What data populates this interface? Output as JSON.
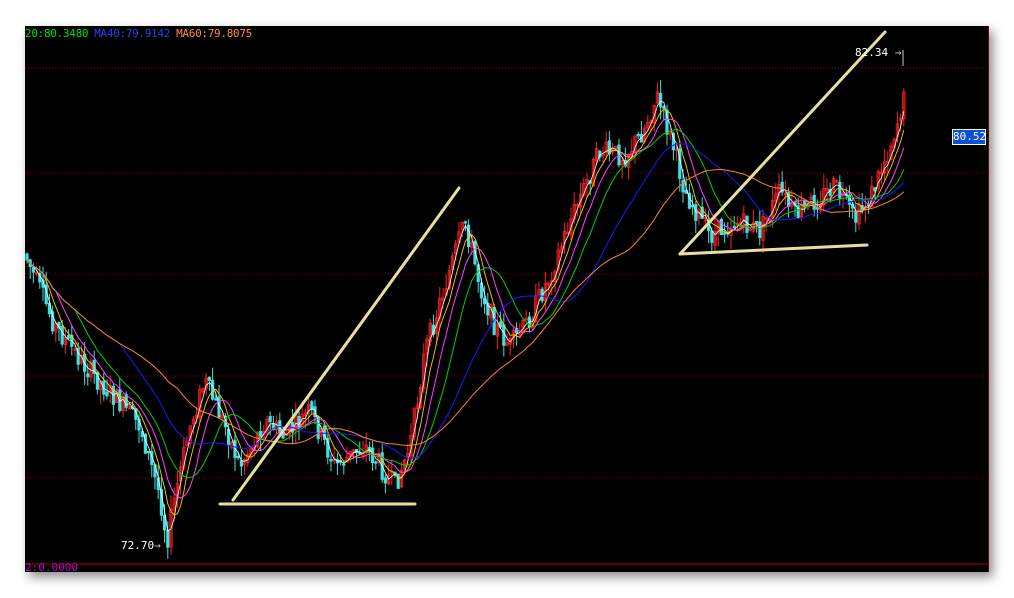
{
  "legend": {
    "ma20": "20:80.3480",
    "ma40": "MA40:79.9142",
    "ma60": "MA60:79.8075"
  },
  "price_labels": {
    "high": "82.34",
    "low": "72.70",
    "current": "80.52"
  },
  "indicator_label": "2:0.0000",
  "colors": {
    "background": "#000000",
    "grid": "#8a0000",
    "candle_up": "#ff2020",
    "candle_down": "#40e0e0",
    "ma5": "#ffffff",
    "ma10": "#ffd000",
    "ma20": "#ff40ff",
    "ma_green": "#00d000",
    "ma40": "#1a1aff",
    "ma60": "#ff8030",
    "trendline": "#e6e0a0"
  },
  "chart_data": {
    "type": "candlestick",
    "price_range": [
      72.7,
      82.34
    ],
    "moving_averages": [
      {
        "name": "MA20",
        "value": 80.348
      },
      {
        "name": "MA40",
        "value": 79.9142
      },
      {
        "name": "MA60",
        "value": 79.8075
      }
    ],
    "annotations": [
      "ascending-triangle pattern (left)",
      "ascending-triangle pattern (right)"
    ]
  }
}
